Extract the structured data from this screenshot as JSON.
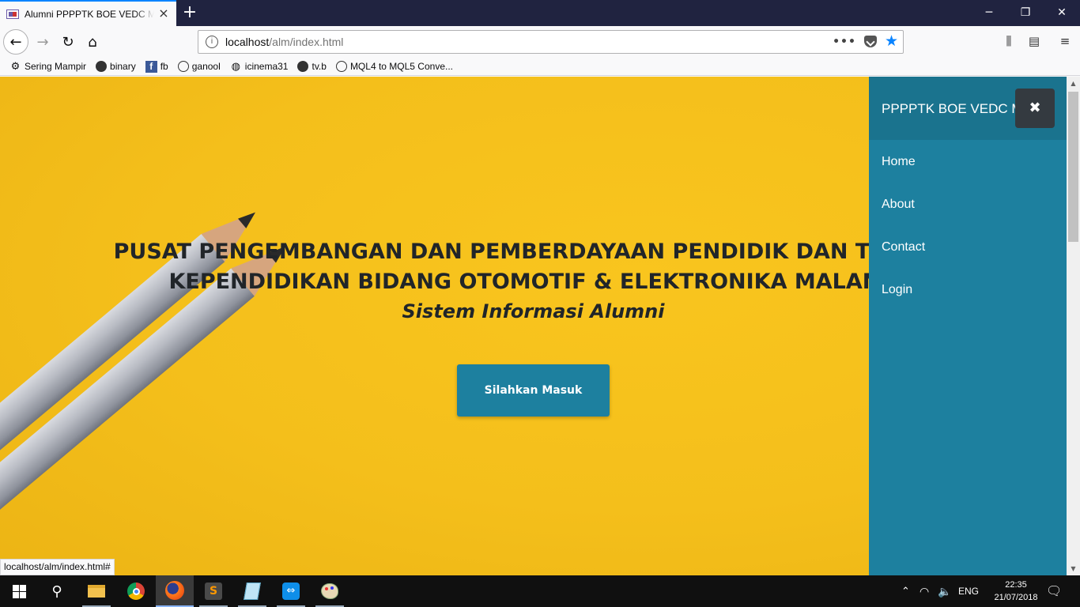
{
  "browser": {
    "tab_title": "Alumni PPPPTK BOE VEDC Malang",
    "url_host": "localhost",
    "url_path": "/alm/index.html",
    "status_text": "localhost/alm/index.html#",
    "accent_color": "#0a84ff"
  },
  "bookmarks": [
    {
      "label": "Sering Mampir",
      "icon": "gear-icon"
    },
    {
      "label": "binary",
      "icon": "swirl-icon"
    },
    {
      "label": "fb",
      "icon": "facebook-icon"
    },
    {
      "label": "ganool",
      "icon": "globe-icon"
    },
    {
      "label": "icinema31",
      "icon": "film-icon"
    },
    {
      "label": "tv.b",
      "icon": "swirl-icon"
    },
    {
      "label": "MQL4 to MQL5 Conve...",
      "icon": "globe-icon"
    }
  ],
  "hero": {
    "title_line1": "PUSAT PENGEMBANGAN DAN PEMBERDAYAAN PENDIDIK DAN TENAGA",
    "title_line2": "KEPENDIDIKAN BIDANG OTOMOTIF & ELEKTRONIKA MALANG",
    "subtitle": "Sistem Informasi Alumni",
    "button_label": "Silahkan Masuk",
    "background_color": "#f4bf1b"
  },
  "sidebar": {
    "brand": "PPPPTK BOE VEDC Malang",
    "close_icon": "close-icon",
    "items": [
      {
        "label": "Home"
      },
      {
        "label": "About"
      },
      {
        "label": "Contact"
      },
      {
        "label": "Login"
      }
    ],
    "color": "#1d809f"
  },
  "taskbar": {
    "apps": [
      "file-explorer-icon",
      "chrome-icon",
      "firefox-icon",
      "sublime-text-icon",
      "notepad-icon",
      "teamviewer-icon",
      "paint-icon"
    ],
    "language": "ENG",
    "time": "22:35",
    "date": "21/07/2018"
  }
}
